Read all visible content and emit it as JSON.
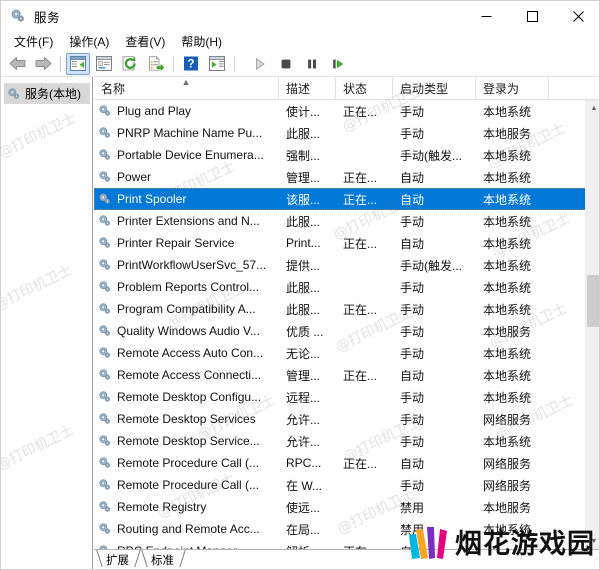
{
  "window": {
    "title": "服务",
    "icon": "services-gear-icon",
    "controls": {
      "minimize": "minimize-icon",
      "maximize": "maximize-icon",
      "close": "close-icon"
    }
  },
  "menu": {
    "items": [
      {
        "label": "文件(F)",
        "name": "menu-file"
      },
      {
        "label": "操作(A)",
        "name": "menu-action"
      },
      {
        "label": "查看(V)",
        "name": "menu-view"
      },
      {
        "label": "帮助(H)",
        "name": "menu-help"
      }
    ]
  },
  "toolbar": {
    "buttons": [
      {
        "name": "back-icon",
        "kind": "arrow-left"
      },
      {
        "name": "forward-icon",
        "kind": "arrow-right"
      },
      {
        "name": "show-hide-tree-icon",
        "kind": "panel",
        "active": true
      },
      {
        "name": "properties-icon",
        "kind": "window"
      },
      {
        "name": "refresh-icon",
        "kind": "refresh"
      },
      {
        "name": "export-list-icon",
        "kind": "export"
      },
      {
        "name": "help-icon",
        "kind": "help"
      },
      {
        "name": "show-action-pane-icon",
        "kind": "actionpane"
      },
      {
        "name": "start-service-icon",
        "kind": "play"
      },
      {
        "name": "stop-service-icon",
        "kind": "stop"
      },
      {
        "name": "pause-service-icon",
        "kind": "pause"
      },
      {
        "name": "restart-service-icon",
        "kind": "restart"
      }
    ]
  },
  "sidebar": {
    "root": {
      "label": "服务(本地)",
      "icon": "services-gear-icon",
      "selected": true
    }
  },
  "list": {
    "columns": [
      {
        "label": "名称",
        "name": "column-name",
        "width": 185,
        "sorted": "asc"
      },
      {
        "label": "描述",
        "name": "column-description",
        "width": 57
      },
      {
        "label": "状态",
        "name": "column-status",
        "width": 57
      },
      {
        "label": "启动类型",
        "name": "column-startup",
        "width": 83
      },
      {
        "label": "登录为",
        "name": "column-logon",
        "width": 73
      }
    ],
    "rows": [
      {
        "name": "Plug and Play",
        "description": "使计...",
        "status": "正在...",
        "startup": "手动",
        "logon": "本地系统",
        "selected": false
      },
      {
        "name": "PNRP Machine Name Pu...",
        "description": "此服...",
        "status": "",
        "startup": "手动",
        "logon": "本地服务",
        "selected": false
      },
      {
        "name": "Portable Device Enumera...",
        "description": "强制...",
        "status": "",
        "startup": "手动(触发...",
        "logon": "本地系统",
        "selected": false
      },
      {
        "name": "Power",
        "description": "管理...",
        "status": "正在...",
        "startup": "自动",
        "logon": "本地系统",
        "selected": false
      },
      {
        "name": "Print Spooler",
        "description": "该服...",
        "status": "正在...",
        "startup": "自动",
        "logon": "本地系统",
        "selected": true
      },
      {
        "name": "Printer Extensions and N...",
        "description": "此服...",
        "status": "",
        "startup": "手动",
        "logon": "本地系统",
        "selected": false
      },
      {
        "name": "Printer Repair Service",
        "description": "Print...",
        "status": "正在...",
        "startup": "自动",
        "logon": "本地系统",
        "selected": false
      },
      {
        "name": "PrintWorkflowUserSvc_57...",
        "description": "提供...",
        "status": "",
        "startup": "手动(触发...",
        "logon": "本地系统",
        "selected": false
      },
      {
        "name": "Problem Reports Control...",
        "description": "此服...",
        "status": "",
        "startup": "手动",
        "logon": "本地系统",
        "selected": false
      },
      {
        "name": "Program Compatibility A...",
        "description": "此服...",
        "status": "正在...",
        "startup": "手动",
        "logon": "本地系统",
        "selected": false
      },
      {
        "name": "Quality Windows Audio V...",
        "description": "优质 ...",
        "status": "",
        "startup": "手动",
        "logon": "本地服务",
        "selected": false
      },
      {
        "name": "Remote Access Auto Con...",
        "description": "无论...",
        "status": "",
        "startup": "手动",
        "logon": "本地系统",
        "selected": false
      },
      {
        "name": "Remote Access Connecti...",
        "description": "管理...",
        "status": "正在...",
        "startup": "自动",
        "logon": "本地系统",
        "selected": false
      },
      {
        "name": "Remote Desktop Configu...",
        "description": "远程...",
        "status": "",
        "startup": "手动",
        "logon": "本地系统",
        "selected": false
      },
      {
        "name": "Remote Desktop Services",
        "description": "允许...",
        "status": "",
        "startup": "手动",
        "logon": "网络服务",
        "selected": false
      },
      {
        "name": "Remote Desktop Service...",
        "description": "允许...",
        "status": "",
        "startup": "手动",
        "logon": "本地系统",
        "selected": false
      },
      {
        "name": "Remote Procedure Call (...",
        "description": "RPC...",
        "status": "正在...",
        "startup": "自动",
        "logon": "网络服务",
        "selected": false
      },
      {
        "name": "Remote Procedure Call (...",
        "description": "在 W...",
        "status": "",
        "startup": "手动",
        "logon": "网络服务",
        "selected": false
      },
      {
        "name": "Remote Registry",
        "description": "使远...",
        "status": "",
        "startup": "禁用",
        "logon": "本地服务",
        "selected": false
      },
      {
        "name": "Routing and Remote Acc...",
        "description": "在局...",
        "status": "",
        "startup": "禁用",
        "logon": "本地系统",
        "selected": false
      },
      {
        "name": "RPC Endpoint Mapper",
        "description": "解析 ...",
        "status": "正在...",
        "startup": "自动",
        "logon": "",
        "selected": false
      }
    ]
  },
  "tabs": [
    {
      "label": "扩展",
      "name": "tab-extended",
      "active": false
    },
    {
      "label": "标准",
      "name": "tab-standard",
      "active": true
    }
  ],
  "watermark": {
    "text": "@打印机卫士",
    "logo_text": "烟花游戏园"
  },
  "colors": {
    "selection": "#0078d7",
    "toolbar_active": "#cfe4fa",
    "scrollbar_thumb": "#cdcdcd"
  }
}
